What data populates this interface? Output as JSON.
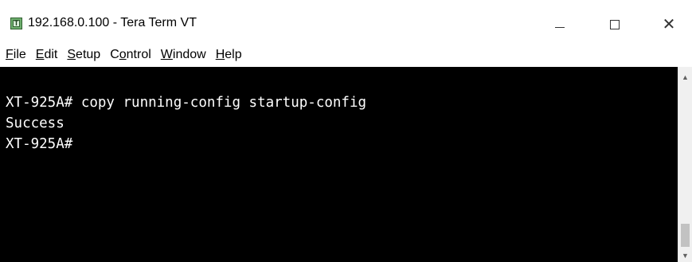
{
  "window": {
    "title": "192.168.0.100 - Tera Term VT",
    "icon": "tera-term-app-icon",
    "icon_glyph": "T",
    "controls": {
      "minimize": "minimize-icon",
      "maximize": "maximize-icon",
      "close": "close-icon",
      "close_glyph": "✕"
    }
  },
  "menubar": {
    "items": [
      {
        "label": "File",
        "mnemonic": "F",
        "rest": "ile"
      },
      {
        "label": "Edit",
        "mnemonic": "E",
        "rest": "dit"
      },
      {
        "label": "Setup",
        "mnemonic": "S",
        "rest": "etup"
      },
      {
        "label": "Control",
        "pre": "C",
        "mnemonic": "o",
        "rest": "ntrol"
      },
      {
        "label": "Window",
        "mnemonic": "W",
        "rest": "indow"
      },
      {
        "label": "Help",
        "mnemonic": "H",
        "rest": "elp"
      }
    ]
  },
  "terminal": {
    "lines": [
      "XT-925A# copy running-config startup-config",
      "Success",
      "XT-925A#"
    ],
    "background": "#000000",
    "foreground": "#ffffff"
  },
  "scrollbar": {
    "up_glyph": "▲",
    "down_glyph": "▼"
  }
}
